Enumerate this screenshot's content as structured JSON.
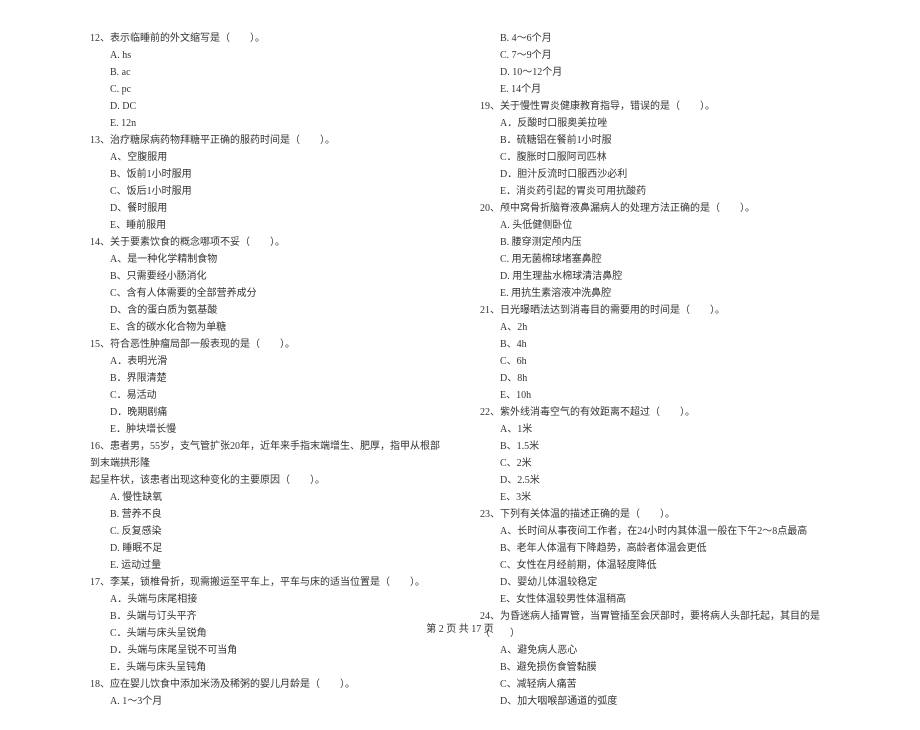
{
  "left_column": {
    "q12": {
      "stem": "12、表示临睡前的外文缩写是（　　）。",
      "options": [
        "A. hs",
        "B. ac",
        "C. pc",
        "D. DC",
        "E. 12n"
      ]
    },
    "q13": {
      "stem": "13、治疗糖尿病药物拜糖平正确的服药时间是（　　）。",
      "options": [
        "A、空腹服用",
        "B、饭前1小时服用",
        "C、饭后1小时服用",
        "D、餐时服用",
        "E、睡前服用"
      ]
    },
    "q14": {
      "stem": "14、关于要素饮食的概念哪项不妥（　　）。",
      "options": [
        "A、是一种化学精制食物",
        "B、只需要经小肠消化",
        "C、含有人体需要的全部营养成分",
        "D、含的蛋白质为氨基酸",
        "E、含的碳水化合物为单糖"
      ]
    },
    "q15": {
      "stem": "15、符合恶性肿瘤局部一般表现的是（　　）。",
      "options": [
        "A．表明光滑",
        "B．界限清楚",
        "C．易活动",
        "D．晚期剧痛",
        "E．肿块增长慢"
      ]
    },
    "q16": {
      "stem": "16、患者男，55岁，支气管扩张20年，近年来手指末端增生、肥厚，指甲从根部到末端拱形隆",
      "stem_cont": "起呈杵状，该患者出现这种变化的主要原因（　　）。",
      "options": [
        "A. 慢性缺氧",
        "B. 营养不良",
        "C. 反复感染",
        "D. 睡眠不足",
        "E. 运动过量"
      ]
    },
    "q17": {
      "stem": "17、李某，锁椎骨折，现需搬运至平车上，平车与床的适当位置是（　　）。",
      "options": [
        "A．头端与床尾相接",
        "B．头端与订头平齐",
        "C．头端与床头呈锐角",
        "D．头端与床尾呈锐不可当角",
        "E．头端与床头呈钝角"
      ]
    },
    "q18": {
      "stem": "18、应在婴儿饮食中添加米汤及稀粥的婴儿月龄是（　　）。",
      "options": [
        "A. 1～3个月"
      ]
    }
  },
  "right_column": {
    "q18_cont": {
      "options": [
        "B. 4～6个月",
        "C. 7～9个月",
        "D. 10～12个月",
        "E. 14个月"
      ]
    },
    "q19": {
      "stem": "19、关于慢性胃炎健康教育指导，错误的是（　　）。",
      "options": [
        "A．反酸时口服奥美拉唑",
        "B．硫糖铝在餐前1小时服",
        "C．腹胀时口服阿司匹林",
        "D．胆汁反流时口服西沙必利",
        "E．消炎药引起的胃炎可用抗酸药"
      ]
    },
    "q20": {
      "stem": "20、颅中窝骨折脑脊液鼻漏病人的处理方法正确的是（　　）。",
      "options": [
        "A. 头低健侧卧位",
        "B. 腰穿测定颅内压",
        "C. 用无菌棉球堵塞鼻腔",
        "D. 用生理盐水棉球清洁鼻腔",
        "E. 用抗生素溶液冲洗鼻腔"
      ]
    },
    "q21": {
      "stem": "21、日光曝晒法达到消毒目的需要用的时间是（　　）。",
      "options": [
        "A、2h",
        "B、4h",
        "C、6h",
        "D、8h",
        "E、10h"
      ]
    },
    "q22": {
      "stem": "22、紫外线消毒空气的有效距离不超过（　　）。",
      "options": [
        "A、1米",
        "B、1.5米",
        "C、2米",
        "D、2.5米",
        "E、3米"
      ]
    },
    "q23": {
      "stem": "23、下列有关体温的描述正确的是（　　）。",
      "options": [
        "A、长时间从事夜间工作者，在24小时内其体温一般在下午2～8点最高",
        "B、老年人体温有下降趋势，高龄者体温会更低",
        "C、女性在月经前期，体温轻度降低",
        "D、婴幼儿体温较稳定",
        "E、女性体温较男性体温稍高"
      ]
    },
    "q24": {
      "stem": "24、为昏迷病人插胃管，当胃管插至会厌部时，要将病人头部托起，其目的是（　　）",
      "options": [
        "A、避免病人恶心",
        "B、避免损伤食管黏膜",
        "C、减轻病人痛苦",
        "D、加大咽喉部通道的弧度"
      ]
    }
  },
  "footer": "第 2 页 共 17 页"
}
